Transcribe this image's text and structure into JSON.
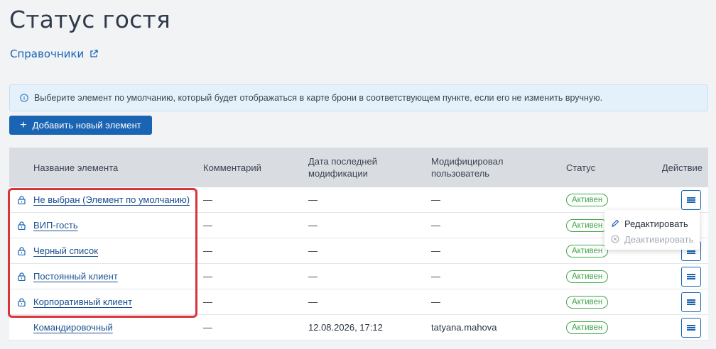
{
  "page": {
    "title": "Статус гостя"
  },
  "reference_link": {
    "label": "Справочники",
    "icon": "external-link-icon"
  },
  "info": {
    "icon": "info-icon",
    "text": "Выберите элемент по умолчанию, который будет отображаться в карте брони в соответствующем пункте, если его не изменить вручную."
  },
  "add_button": {
    "icon": "plus-icon",
    "label": "Добавить новый элемент"
  },
  "table": {
    "headers": {
      "name": "Название элемента",
      "comment": "Комментарий",
      "date_line1": "Дата последней",
      "date_line2": "модификации",
      "user_line1": "Модифицировал",
      "user_line2": "пользователь",
      "status": "Статус",
      "action": "Действие"
    },
    "rows": [
      {
        "locked": true,
        "name": "Не выбран (Элемент по умолчанию)",
        "comment": "—",
        "date": "—",
        "user": "—",
        "status": "Активен"
      },
      {
        "locked": true,
        "name": "ВИП-гость",
        "comment": "—",
        "date": "—",
        "user": "—",
        "status": "Активен"
      },
      {
        "locked": true,
        "name": "Черный список",
        "comment": "—",
        "date": "—",
        "user": "—",
        "status": "Активен"
      },
      {
        "locked": true,
        "name": "Постоянный клиент",
        "comment": "—",
        "date": "—",
        "user": "—",
        "status": "Активен"
      },
      {
        "locked": true,
        "name": "Корпоративный клиент",
        "comment": "—",
        "date": "—",
        "user": "—",
        "status": "Активен"
      },
      {
        "locked": false,
        "name": "Командировочный",
        "comment": "—",
        "date": "12.08.2026, 17:12",
        "user": "tatyana.mahova",
        "status": "Активен"
      }
    ]
  },
  "dropdown": {
    "edit": {
      "icon": "pencil-icon",
      "label": "Редактировать"
    },
    "deactivate": {
      "icon": "deactivate-icon",
      "label": "Деактивировать"
    }
  },
  "colors": {
    "accent": "#1a64b4",
    "status_active": "#3fa648",
    "highlight": "#d9343a"
  }
}
